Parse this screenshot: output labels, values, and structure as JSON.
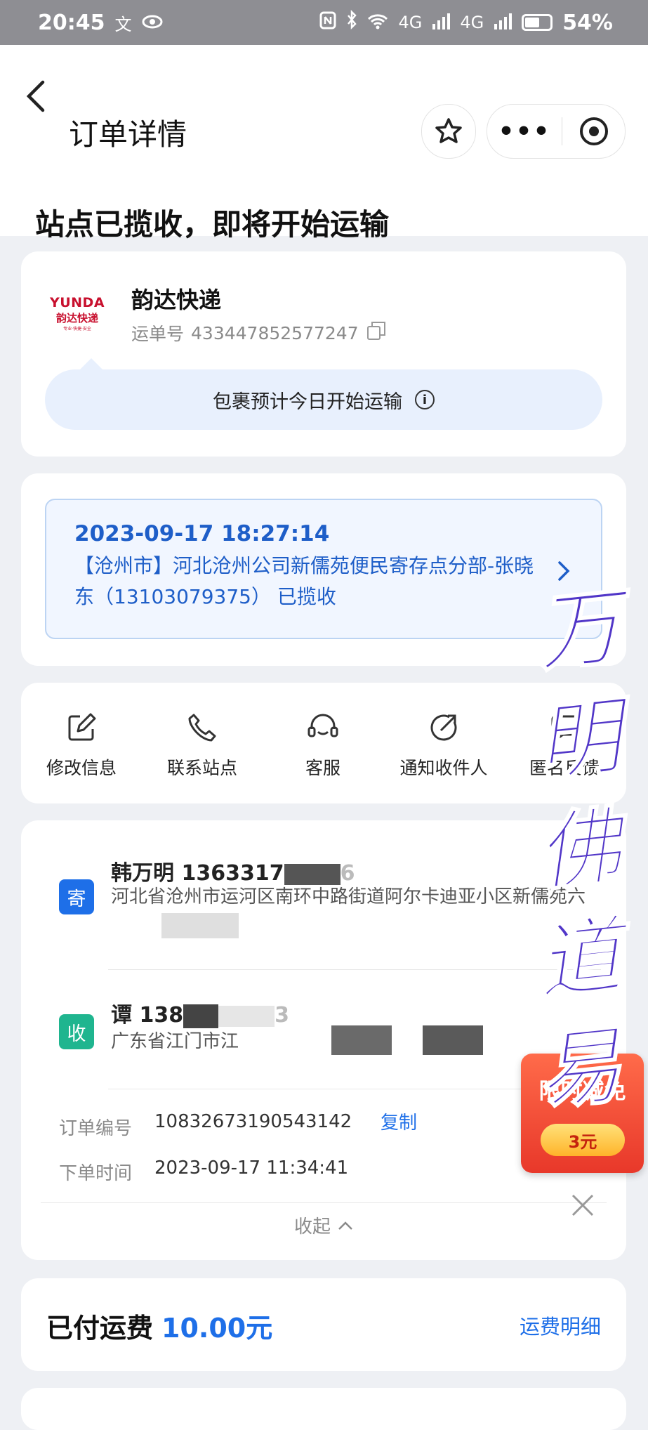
{
  "status_bar": {
    "time": "20:45",
    "left_extra": "文",
    "network": "4G",
    "battery": "54%"
  },
  "nav": {
    "title": "订单详情",
    "more": "•••"
  },
  "order_status": "站点已揽收，即将开始运输",
  "carrier": {
    "logo_text": "YUNDA",
    "logo_cn": "韵达快递",
    "logo_tagline": "专业·快捷·安全",
    "name": "韵达快递",
    "waybill_label": "运单号",
    "waybill_no": "433447852577247",
    "notice": "包裹预计今日开始运输"
  },
  "tracking": {
    "time": "2023-09-17 18:27:14",
    "desc": "【沧州市】河北沧州公司新儒苑便民寄存点分部-张晓东（13103079375） 已揽收"
  },
  "actions": [
    {
      "label": "修改信息",
      "icon": "edit-icon"
    },
    {
      "label": "联系站点",
      "icon": "phone-icon"
    },
    {
      "label": "客服",
      "icon": "headset-icon"
    },
    {
      "label": "通知收件人",
      "icon": "notify-icon"
    },
    {
      "label": "匿名反馈",
      "icon": "feedback-icon"
    }
  ],
  "sender": {
    "badge": "寄",
    "name_phone_visible": "韩万明 1363317",
    "phone_tail": "6",
    "address": "河北省沧州市运河区南环中路街道阿尔卡迪亚小区新儒苑六"
  },
  "receiver": {
    "badge": "收",
    "name_phone_visible": "谭 138",
    "phone_tail": "3",
    "address": "广东省江门市江"
  },
  "order_info": {
    "order_no_label": "订单编号",
    "order_no": "10832673190543142",
    "copy": "复制",
    "order_time_label": "下单时间",
    "order_time": "2023-09-17 11:34:41",
    "collapse": "收起"
  },
  "fee": {
    "label": "已付运费",
    "amount": "10.00元",
    "detail_link": "运费明细"
  },
  "promo": {
    "title": "限时减免",
    "amount": "3元"
  },
  "watermark": [
    "万",
    "明",
    "佛",
    "道",
    "易"
  ]
}
